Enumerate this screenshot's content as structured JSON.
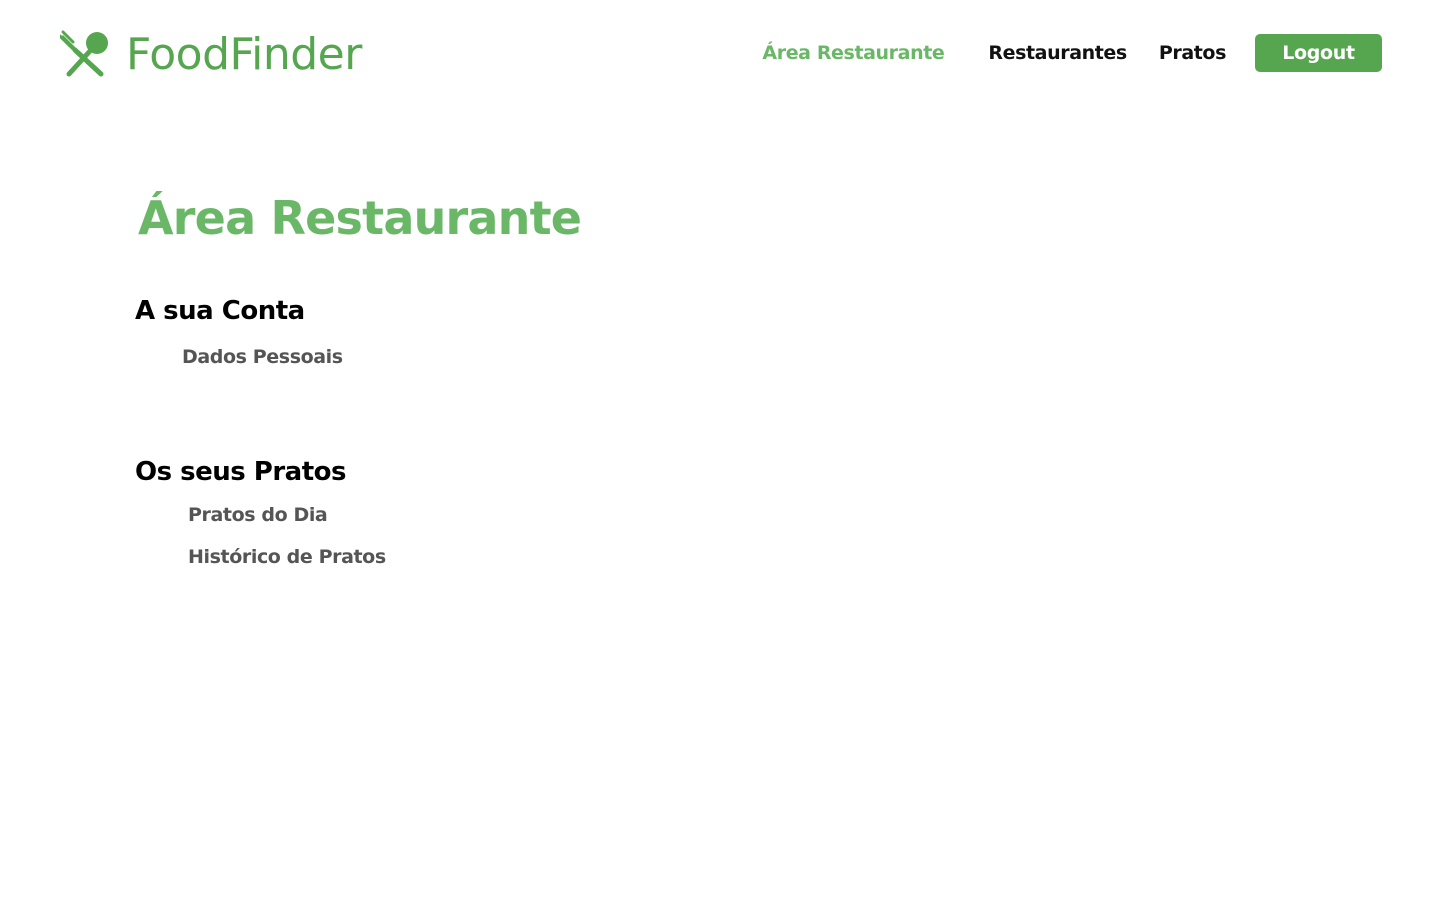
{
  "header": {
    "brand_name": "FoodFinder",
    "brand_icon": "fork-and-spoon-icon",
    "nav": {
      "area_restaurante": "Área Restaurante",
      "restaurantes": "Restaurantes",
      "pratos": "Pratos",
      "logout": "Logout"
    }
  },
  "main": {
    "title": "Área Restaurante",
    "sections": [
      {
        "heading": "A sua Conta",
        "links": [
          "Dados Pessoais"
        ]
      },
      {
        "heading": "Os seus Pratos",
        "links": [
          "Pratos do Dia",
          "Histórico de Pratos"
        ]
      }
    ]
  },
  "colors": {
    "brand_green": "#56a650",
    "accent_green": "#6ab867",
    "link_gray": "#555555",
    "heading_black": "#000000"
  }
}
